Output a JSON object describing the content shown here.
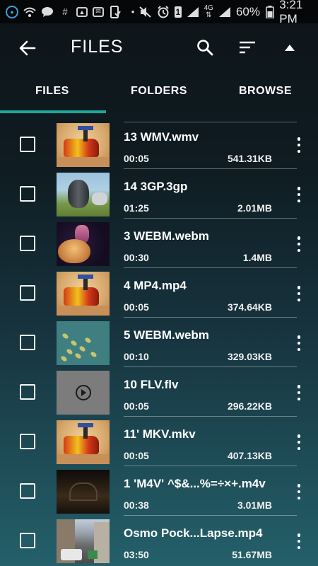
{
  "status_bar": {
    "network_type": "4G",
    "battery": "60%",
    "time": "3:21 PM"
  },
  "app_bar": {
    "title": "FILES"
  },
  "tabs": [
    {
      "label": "FILES",
      "selected": true
    },
    {
      "label": "FOLDERS",
      "selected": false
    },
    {
      "label": "BROWSE",
      "selected": false
    }
  ],
  "colors": {
    "accent": "#1fa89a",
    "status_bar_bg": "#050708"
  },
  "files": [
    {
      "name": "13 WMV.wmv",
      "duration": "00:05",
      "size": "541.31KB",
      "thumb": "lego-robot"
    },
    {
      "name": "14 3GP.3gp",
      "duration": "01:25",
      "size": "2.01MB",
      "thumb": "penguin"
    },
    {
      "name": "3 WEBM.webm",
      "duration": "00:30",
      "size": "1.4MB",
      "thumb": "jellyfish"
    },
    {
      "name": "4 MP4.mp4",
      "duration": "00:05",
      "size": "374.64KB",
      "thumb": "lego-robot"
    },
    {
      "name": "5 WEBM.webm",
      "duration": "00:10",
      "size": "329.03KB",
      "thumb": "leaves"
    },
    {
      "name": "10 FLV.flv",
      "duration": "00:05",
      "size": "296.22KB",
      "thumb": "play-placeholder"
    },
    {
      "name": "11' MKV.mkv",
      "duration": "00:05",
      "size": "407.13KB",
      "thumb": "lego-robot"
    },
    {
      "name": "1 'M4V' ^$&...%=÷×+.m4v",
      "duration": "00:38",
      "size": "3.01MB",
      "thumb": "dark-interior"
    },
    {
      "name": "Osmo Pock...Lapse.mp4",
      "duration": "03:50",
      "size": "51.67MB",
      "thumb": "street"
    }
  ]
}
